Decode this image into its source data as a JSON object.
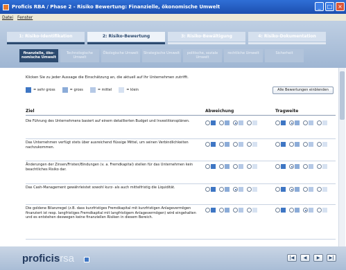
{
  "window": {
    "title": "Proficis RBA / Phase 2 - Risiko Bewertung: Finanzielle, ökonomische Umwelt",
    "minimize_glyph": "_",
    "maximize_glyph": "□",
    "close_glyph": "×"
  },
  "menu": {
    "items": [
      "Datei",
      "Fenster"
    ]
  },
  "phases": [
    {
      "label": "1: Risiko-Identifikation",
      "active": false,
      "completed": true
    },
    {
      "label": "2: Risiko-Bewertung",
      "active": true,
      "completed": true
    },
    {
      "label": "3: Risiko-Bewältigung",
      "active": false,
      "completed": false
    },
    {
      "label": "4: Risiko-Dokumentation",
      "active": false,
      "completed": false
    }
  ],
  "subtabs": [
    {
      "label": "finanzielle, öko-nomische Umwelt",
      "active": true
    },
    {
      "label": "Technologische Umwelt",
      "active": false
    },
    {
      "label": "Ökologische Umwelt",
      "active": false
    },
    {
      "label": "Strategische Umwelt",
      "active": false
    },
    {
      "label": "politische, soziale Umwelt",
      "active": false
    },
    {
      "label": "rechtliche Umwelt",
      "active": false
    },
    {
      "label": "Sicherheit",
      "active": false
    }
  ],
  "instruction": "Klicken Sie zu jeder Aussage die Einschätzung an, die aktuell auf Ihr Unternehmen zutrifft.",
  "legend": [
    {
      "label": "= sehr gross",
      "color": "#3e76c4"
    },
    {
      "label": "= gross",
      "color": "#8cacd8"
    },
    {
      "label": "= mittel",
      "color": "#b5c9e6"
    },
    {
      "label": "= klein",
      "color": "#d6e1f1"
    }
  ],
  "show_all_button": "Alle Bewertungen einblenden",
  "columns": {
    "goal": "Ziel",
    "deviation": "Abweichung",
    "impact": "Tragweite"
  },
  "rows": [
    {
      "text": "Die Führung des Unternehmens basiert auf einem detaillierten Budget und Investitionsplänen.",
      "deviation": 2,
      "impact": 1
    },
    {
      "text": "Das Unternehmen verfügt stets über ausreichend flüssige Mittel, um seinen Verbindlichkeiten nachzukommen.",
      "deviation": -1,
      "impact": -1
    },
    {
      "text": "Änderungen der Zinsen/Fristen/Bindungen (v. a. Fremdkapital) stellen für das Unternehmen kein beachtliches Risiko dar.",
      "deviation": -1,
      "impact": 1
    },
    {
      "text": "Das Cash-Management gewährleistet sowohl kurz- als auch mittelfristig die Liquidität.",
      "deviation": 2,
      "impact": 1
    },
    {
      "text": "Die goldene Bilanzregel (z.B. dass kurzfristiges Fremdkapital mit kurzfristigen Anlagevermögen finanziert ist resp. langfristiges Fremdkapital mit langfristigem Anlagevermögen) wird eingehalten und es entstehen deswegen keine finanziellen Risiken in diesem Bereich.",
      "deviation": -1,
      "impact": 2
    }
  ],
  "rating_colors": [
    "#3e76c4",
    "#8cacd8",
    "#b5c9e6",
    "#d6e1f1"
  ],
  "footer": {
    "logo_main": "proficis",
    "logo_sub": "rsa",
    "nav_buttons": [
      "|◀",
      "◀",
      "▶",
      "▶|"
    ]
  }
}
